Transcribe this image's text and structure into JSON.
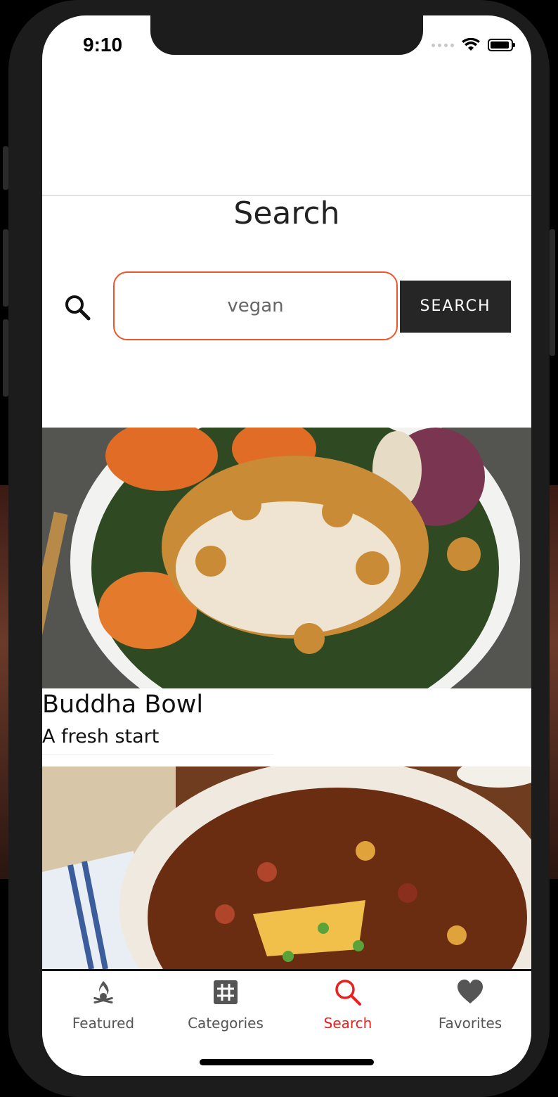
{
  "status_bar": {
    "time": "9:10"
  },
  "page": {
    "title": "Search"
  },
  "search": {
    "value": "vegan",
    "button_label": "SEARCH"
  },
  "results": [
    {
      "title": "Buddha Bowl",
      "subtitle": "A fresh start"
    },
    {
      "title": "",
      "subtitle": ""
    }
  ],
  "tabs": [
    {
      "label": "Featured",
      "icon": "campfire-icon",
      "active": false
    },
    {
      "label": "Categories",
      "icon": "grid-icon",
      "active": false
    },
    {
      "label": "Search",
      "icon": "search-icon",
      "active": true
    },
    {
      "label": "Favorites",
      "icon": "heart-icon",
      "active": false
    }
  ],
  "colors": {
    "accent": "#e8201e",
    "input_border": "#f0552a",
    "button_bg": "#262626"
  }
}
